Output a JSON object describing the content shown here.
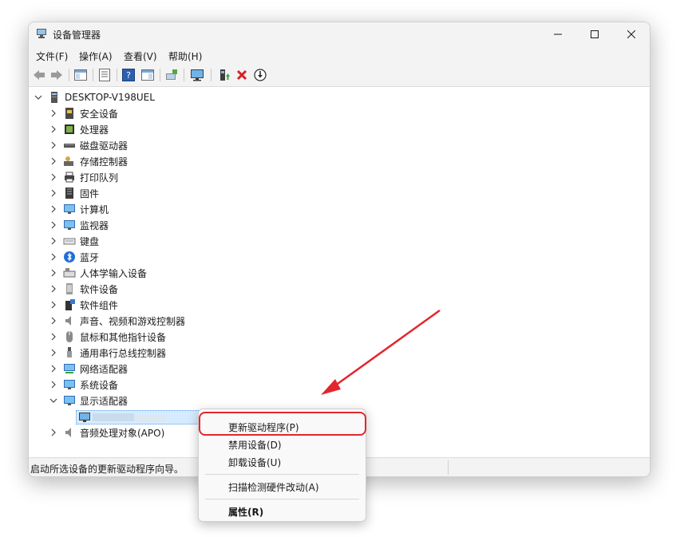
{
  "window": {
    "title": "设备管理器"
  },
  "menubar": {
    "items": [
      "文件(F)",
      "操作(A)",
      "查看(V)",
      "帮助(H)"
    ]
  },
  "toolbar": {
    "buttons": [
      "back-icon",
      "forward-icon",
      "show-hide-console-tree-icon",
      "properties-icon",
      "help-icon",
      "action-pane-icon",
      "scan-hardware-icon",
      "monitor-icon",
      "update-driver-icon",
      "uninstall-icon",
      "download-icon"
    ]
  },
  "tree": {
    "root": "DESKTOP-V198UEL",
    "categories": [
      {
        "label": "安全设备",
        "icon": "security-device-icon"
      },
      {
        "label": "处理器",
        "icon": "processor-icon"
      },
      {
        "label": "磁盘驱动器",
        "icon": "disk-drive-icon"
      },
      {
        "label": "存储控制器",
        "icon": "storage-controller-icon"
      },
      {
        "label": "打印队列",
        "icon": "printer-icon"
      },
      {
        "label": "固件",
        "icon": "firmware-icon"
      },
      {
        "label": "计算机",
        "icon": "computer-icon"
      },
      {
        "label": "监视器",
        "icon": "monitor-icon"
      },
      {
        "label": "键盘",
        "icon": "keyboard-icon"
      },
      {
        "label": "蓝牙",
        "icon": "bluetooth-icon"
      },
      {
        "label": "人体学输入设备",
        "icon": "hid-icon"
      },
      {
        "label": "软件设备",
        "icon": "software-device-icon"
      },
      {
        "label": "软件组件",
        "icon": "software-component-icon"
      },
      {
        "label": "声音、视频和游戏控制器",
        "icon": "sound-icon"
      },
      {
        "label": "鼠标和其他指针设备",
        "icon": "mouse-icon"
      },
      {
        "label": "通用串行总线控制器",
        "icon": "usb-icon"
      },
      {
        "label": "网络适配器",
        "icon": "network-adapter-icon"
      },
      {
        "label": "系统设备",
        "icon": "system-device-icon"
      },
      {
        "label": "显示适配器",
        "icon": "display-adapter-icon"
      },
      {
        "label": "音频处理对象(APO)",
        "icon": "audio-apo-icon"
      }
    ]
  },
  "context_menu": {
    "update_driver": "更新驱动程序(P)",
    "disable_device": "禁用设备(D)",
    "uninstall_device": "卸载设备(U)",
    "scan_hardware": "扫描检测硬件改动(A)",
    "properties": "属性(R)"
  },
  "statusbar": {
    "text": "启动所选设备的更新驱动程序向导。"
  },
  "colors": {
    "highlight": "#e3262c",
    "selection": "#d6ebff"
  }
}
